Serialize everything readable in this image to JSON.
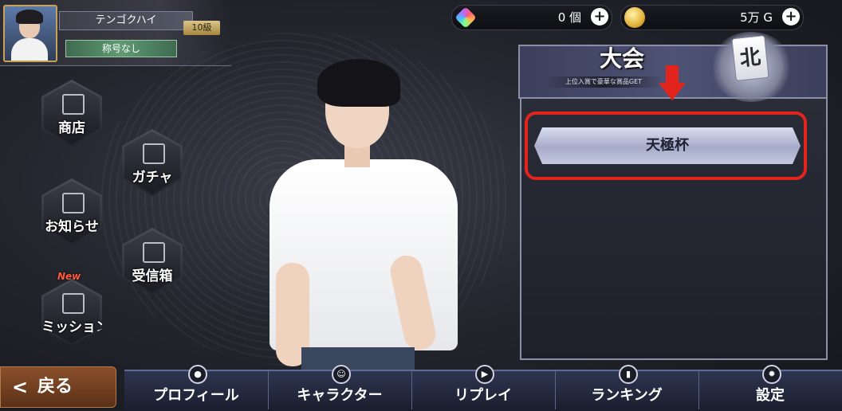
{
  "player": {
    "name": "テンゴクハイ",
    "level": "10級",
    "title": "称号なし"
  },
  "resources": {
    "gems": "0 個",
    "gold": "5万 G",
    "plus": "+"
  },
  "side_menu": {
    "shop": "商店",
    "gacha": "ガチャ",
    "notice": "お知らせ",
    "inbox": "受信箱",
    "mission": "ミッション",
    "new_badge": "New"
  },
  "tournament": {
    "title": "大会",
    "subtitle": "上位入賞で豪華な賞品GET",
    "tile_char": "北",
    "cup_label": "天極杯"
  },
  "bottom_nav": {
    "back": "戻る",
    "tabs": [
      "プロフィール",
      "キャラクター",
      "リプレイ",
      "ランキング",
      "設定"
    ]
  },
  "colors": {
    "highlight": "#e3241c",
    "panel_border": "#8a90a8",
    "gold_accent": "#c9a25a"
  }
}
